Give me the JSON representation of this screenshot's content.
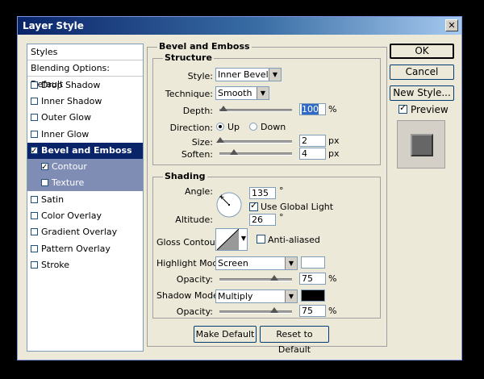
{
  "window": {
    "title": "Layer Style",
    "close": "✕"
  },
  "sidebar": {
    "items": [
      {
        "label": "Styles",
        "checkbox": false,
        "checked": false,
        "state": "plain"
      },
      {
        "label": "Blending Options: Default",
        "checkbox": false,
        "checked": false,
        "state": "plain"
      },
      {
        "label": "Drop Shadow",
        "checkbox": true,
        "checked": false,
        "state": "normal"
      },
      {
        "label": "Inner Shadow",
        "checkbox": true,
        "checked": false,
        "state": "normal"
      },
      {
        "label": "Outer Glow",
        "checkbox": true,
        "checked": false,
        "state": "normal"
      },
      {
        "label": "Inner Glow",
        "checkbox": true,
        "checked": false,
        "state": "normal"
      },
      {
        "label": "Bevel and Emboss",
        "checkbox": true,
        "checked": true,
        "state": "selected"
      },
      {
        "label": "Contour",
        "checkbox": true,
        "checked": true,
        "state": "sub"
      },
      {
        "label": "Texture",
        "checkbox": true,
        "checked": false,
        "state": "sub"
      },
      {
        "label": "Satin",
        "checkbox": true,
        "checked": false,
        "state": "normal"
      },
      {
        "label": "Color Overlay",
        "checkbox": true,
        "checked": false,
        "state": "normal"
      },
      {
        "label": "Gradient Overlay",
        "checkbox": true,
        "checked": false,
        "state": "normal"
      },
      {
        "label": "Pattern Overlay",
        "checkbox": true,
        "checked": false,
        "state": "normal"
      },
      {
        "label": "Stroke",
        "checkbox": true,
        "checked": false,
        "state": "normal"
      }
    ]
  },
  "bevel": {
    "title": "Bevel and Emboss",
    "structure": {
      "title": "Structure",
      "style_label": "Style:",
      "style_value": "Inner Bevel",
      "technique_label": "Technique:",
      "technique_value": "Smooth",
      "depth_label": "Depth:",
      "depth_value": "100",
      "depth_unit": "%",
      "depth_level": 0.05,
      "direction_label": "Direction:",
      "dir_up": "Up",
      "dir_down": "Down",
      "direction": "up",
      "size_label": "Size:",
      "size_value": "2",
      "size_unit": "px",
      "size_level": 0.01,
      "soften_label": "Soften:",
      "soften_value": "4",
      "soften_unit": "px",
      "soften_level": 0.2
    },
    "shading": {
      "title": "Shading",
      "angle_label": "Angle:",
      "angle_value": "135",
      "angle_unit": "°",
      "global_light_label": "Use Global Light",
      "global_light": true,
      "altitude_label": "Altitude:",
      "altitude_value": "26",
      "altitude_unit": "°",
      "gloss_label": "Gloss Contour:",
      "anti_aliased_label": "Anti-aliased",
      "anti_aliased": false,
      "highlight_label": "Highlight Mode:",
      "highlight_value": "Screen",
      "highlight_color": "#ffffff",
      "h_opacity_label": "Opacity:",
      "h_opacity_value": "75",
      "h_opacity_unit": "%",
      "h_opacity_level": 0.75,
      "shadow_label": "Shadow Mode:",
      "shadow_value": "Multiply",
      "shadow_color": "#000000",
      "s_opacity_label": "Opacity:",
      "s_opacity_value": "75",
      "s_opacity_unit": "%",
      "s_opacity_level": 0.75
    },
    "make_default": "Make Default",
    "reset_default": "Reset to Default"
  },
  "actions": {
    "ok": "OK",
    "cancel": "Cancel",
    "new_style": "New Style...",
    "preview_label": "Preview",
    "preview": true
  }
}
